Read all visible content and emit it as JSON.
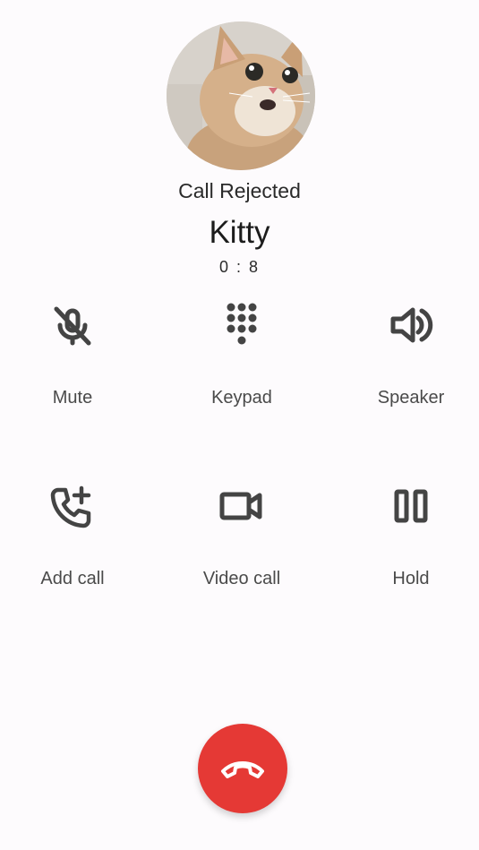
{
  "call": {
    "status": "Call Rejected",
    "contact_name": "Kitty",
    "duration": "0 : 8"
  },
  "controls": [
    {
      "label": "Mute",
      "icon": "mic-off-icon"
    },
    {
      "label": "Keypad",
      "icon": "dialpad-icon"
    },
    {
      "label": "Speaker",
      "icon": "speaker-icon"
    },
    {
      "label": "Add call",
      "icon": "add-call-icon"
    },
    {
      "label": "Video call",
      "icon": "videocam-icon"
    },
    {
      "label": "Hold",
      "icon": "pause-icon"
    }
  ],
  "hangup": {
    "icon": "call-end-icon",
    "color": "#e53935"
  },
  "colors": {
    "background": "#fdfbfd",
    "icon": "#444444",
    "label": "#4a4a4a"
  }
}
